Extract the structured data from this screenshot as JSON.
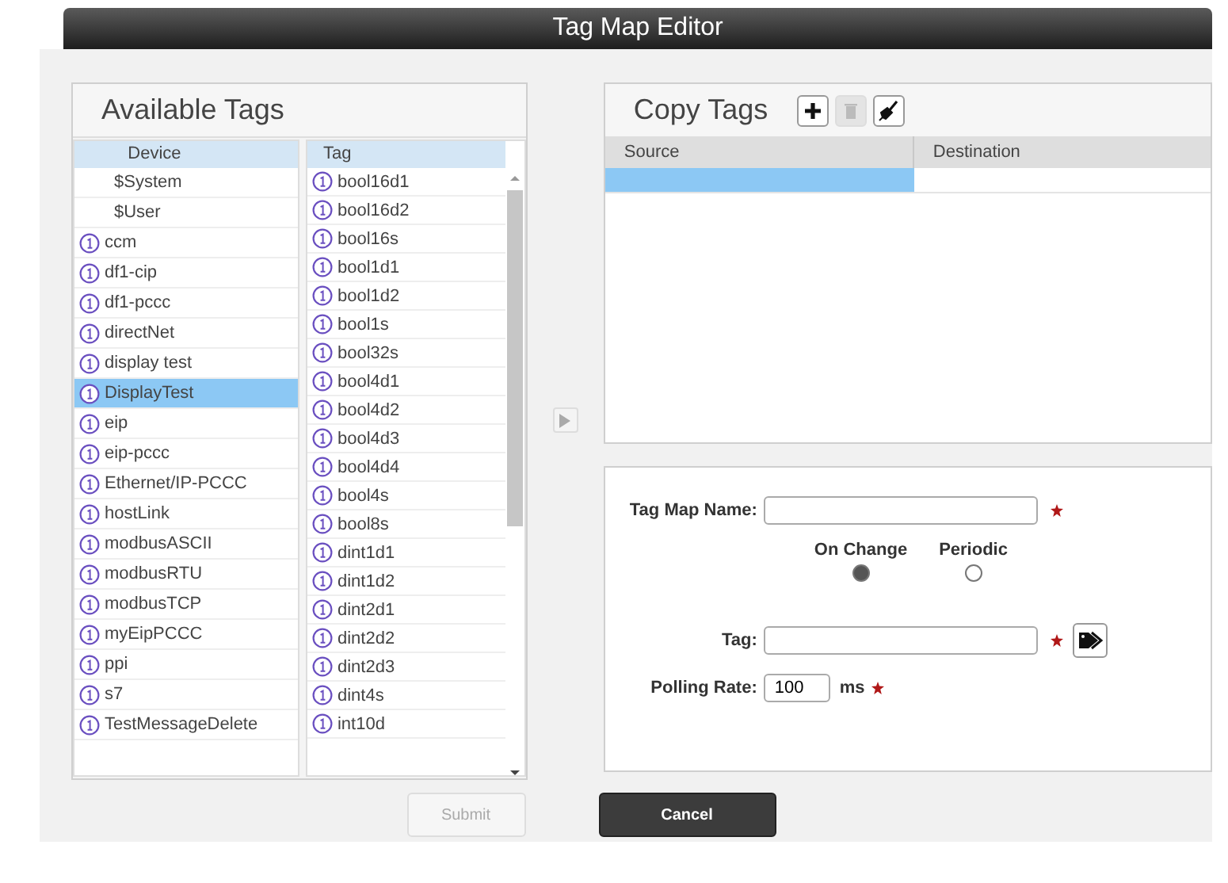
{
  "window": {
    "title": "Tag Map Editor"
  },
  "available_tags": {
    "title": "Available Tags",
    "devices": {
      "header": "Device",
      "items": [
        {
          "label": "$System",
          "kind": "system",
          "selected": false
        },
        {
          "label": "$User",
          "kind": "system",
          "selected": false
        },
        {
          "label": "ccm",
          "kind": "device",
          "selected": false
        },
        {
          "label": "df1-cip",
          "kind": "device",
          "selected": false
        },
        {
          "label": "df1-pccc",
          "kind": "device",
          "selected": false
        },
        {
          "label": "directNet",
          "kind": "device",
          "selected": false
        },
        {
          "label": "display test",
          "kind": "device",
          "selected": false
        },
        {
          "label": "DisplayTest",
          "kind": "device",
          "selected": true
        },
        {
          "label": "eip",
          "kind": "device",
          "selected": false
        },
        {
          "label": "eip-pccc",
          "kind": "device",
          "selected": false
        },
        {
          "label": "Ethernet/IP-PCCC",
          "kind": "device",
          "selected": false
        },
        {
          "label": "hostLink",
          "kind": "device",
          "selected": false
        },
        {
          "label": "modbusASCII",
          "kind": "device",
          "selected": false
        },
        {
          "label": "modbusRTU",
          "kind": "device",
          "selected": false
        },
        {
          "label": "modbusTCP",
          "kind": "device",
          "selected": false
        },
        {
          "label": "myEipPCCC",
          "kind": "device",
          "selected": false
        },
        {
          "label": "ppi",
          "kind": "device",
          "selected": false
        },
        {
          "label": "s7",
          "kind": "device",
          "selected": false
        },
        {
          "label": "TestMessageDelete",
          "kind": "device",
          "selected": false
        }
      ]
    },
    "tags": {
      "header": "Tag",
      "items": [
        {
          "label": "bool16d1",
          "selected": false
        },
        {
          "label": "bool16d2",
          "selected": false
        },
        {
          "label": "bool16s",
          "selected": false
        },
        {
          "label": "bool1d1",
          "selected": false
        },
        {
          "label": "bool1d2",
          "selected": false
        },
        {
          "label": "bool1s",
          "selected": false
        },
        {
          "label": "bool32s",
          "selected": false
        },
        {
          "label": "bool4d1",
          "selected": false
        },
        {
          "label": "bool4d2",
          "selected": false
        },
        {
          "label": "bool4d3",
          "selected": false
        },
        {
          "label": "bool4d4",
          "selected": false
        },
        {
          "label": "bool4s",
          "selected": false
        },
        {
          "label": "bool8s",
          "selected": false
        },
        {
          "label": "dint1d1",
          "selected": false
        },
        {
          "label": "dint1d2",
          "selected": false
        },
        {
          "label": "dint2d1",
          "selected": false
        },
        {
          "label": "dint2d2",
          "selected": false
        },
        {
          "label": "dint2d3",
          "selected": false
        },
        {
          "label": "dint4s",
          "selected": false
        },
        {
          "label": "int10d",
          "selected": false
        }
      ]
    }
  },
  "transfer_button": {
    "disabled": true
  },
  "copy_tags": {
    "title": "Copy Tags",
    "tools": [
      {
        "kind": "add",
        "disabled": false
      },
      {
        "kind": "delete",
        "disabled": true
      },
      {
        "kind": "clear",
        "disabled": false
      }
    ],
    "columns": [
      "Source",
      "Destination"
    ],
    "rows": [
      {
        "selected": true
      }
    ]
  },
  "form": {
    "tag_map_name": {
      "label": "Tag Map Name:",
      "required": true
    },
    "trigger": [
      {
        "label": "On Change",
        "selected": true
      },
      {
        "label": "Periodic",
        "selected": false
      }
    ],
    "tag": {
      "label": "Tag:",
      "required": true
    },
    "polling_rate": {
      "label": "Polling Rate:",
      "value": "100",
      "unit": "ms",
      "required": true
    }
  },
  "buttons": [
    {
      "label": "Submit",
      "kind": "secondary",
      "disabled": true
    },
    {
      "label": "Cancel",
      "kind": "primary",
      "disabled": false
    }
  ]
}
